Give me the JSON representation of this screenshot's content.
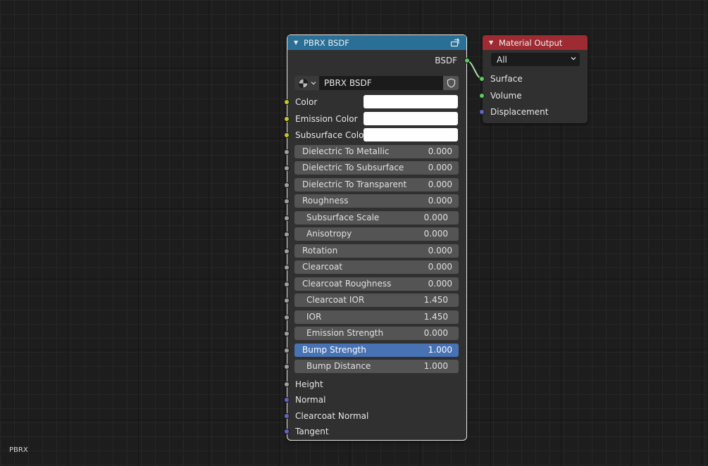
{
  "pbrx_node": {
    "title": "PBRX BSDF",
    "output": "BSDF",
    "group_name": "PBRX BSDF",
    "color_inputs": [
      "Color",
      "Emission Color",
      "Subsurface Colo"
    ],
    "sliders": [
      {
        "label": "Dielectric To Metallic",
        "value": "0.000"
      },
      {
        "label": "Dielectric To Subsurface",
        "value": "0.000"
      },
      {
        "label": "Dielectric To Transparent",
        "value": "0.000"
      },
      {
        "label": "Roughness",
        "value": "0.000"
      },
      {
        "label": "Subsurface Scale",
        "value": "0.000"
      },
      {
        "label": "Anisotropy",
        "value": "0.000"
      },
      {
        "label": "Rotation",
        "value": "0.000"
      },
      {
        "label": "Clearcoat",
        "value": "0.000"
      },
      {
        "label": "Clearcoat Roughness",
        "value": "0.000"
      },
      {
        "label": "Clearcoat IOR",
        "value": "1.450"
      },
      {
        "label": "IOR",
        "value": "1.450"
      },
      {
        "label": "Emission Strength",
        "value": "0.000"
      },
      {
        "label": "Bump Strength",
        "value": "1.000"
      },
      {
        "label": "Bump Distance",
        "value": "1.000"
      }
    ],
    "vector_inputs": [
      "Height",
      "Normal",
      "Clearcoat Normal",
      "Tangent"
    ]
  },
  "material_output": {
    "title": "Material Output",
    "target": "All",
    "inputs": [
      "Surface",
      "Volume",
      "Displacement"
    ]
  },
  "colors": {
    "pbrx_header": "#2a6f96",
    "material_header": "#9e2a32",
    "shader_socket": "#5dcc5d",
    "color_socket": "#c7c729",
    "float_socket": "#a1a1a1",
    "vector_socket": "#6363c7",
    "active_slider": "#4772b3"
  },
  "editor": {
    "node_tree_name": "PBRX"
  }
}
